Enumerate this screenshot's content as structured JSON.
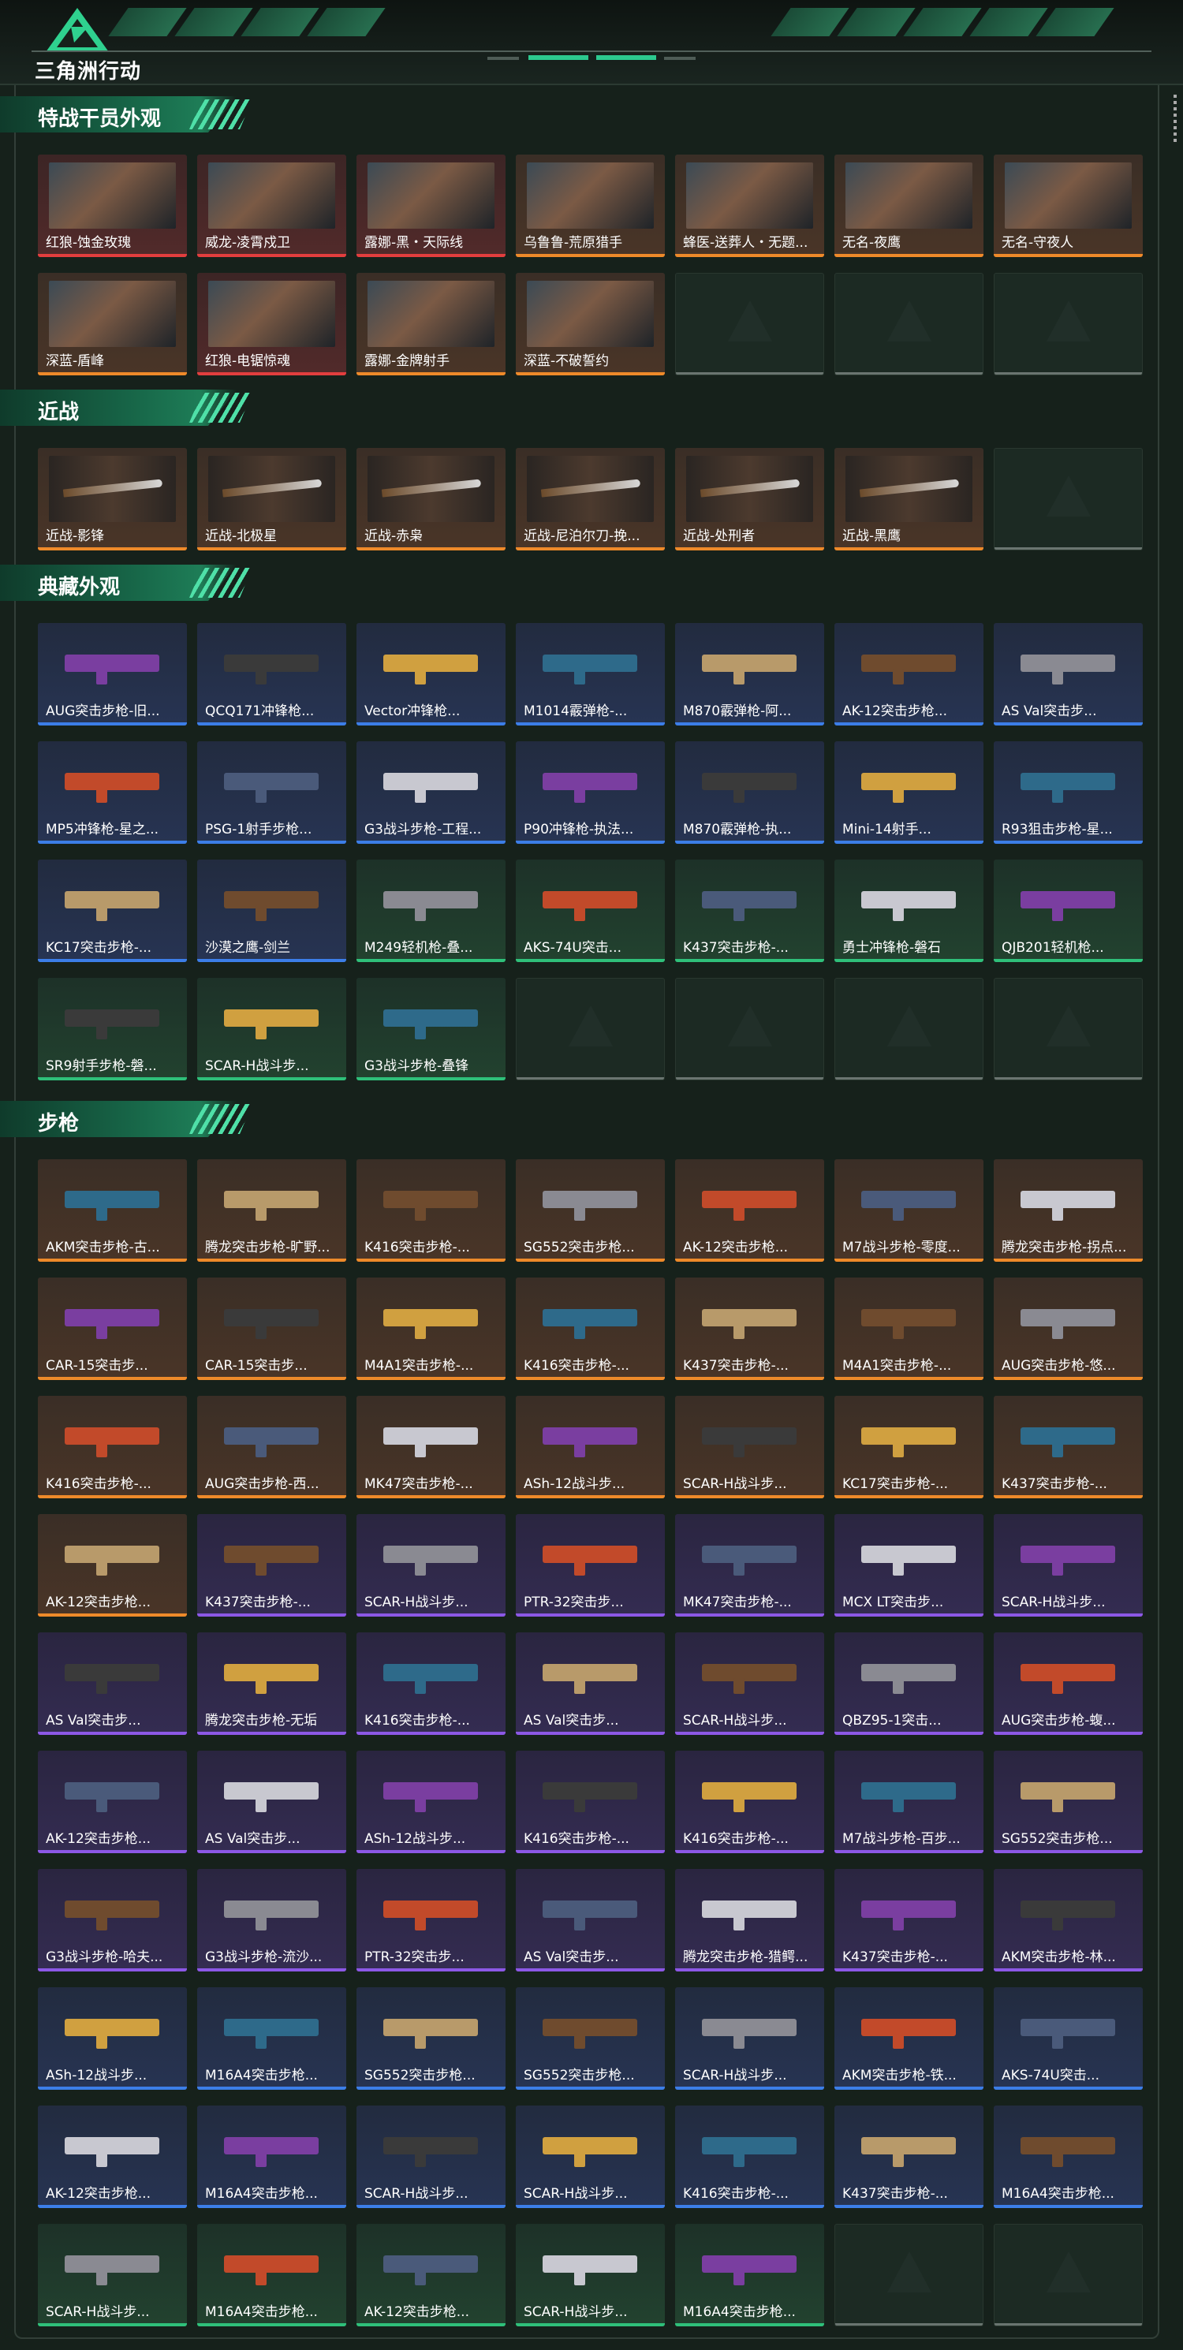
{
  "header": {
    "logo_text": "三角洲行动"
  },
  "sections": [
    {
      "id": "operators",
      "title": "特战干员外观",
      "items": [
        {
          "name": "红狼-蚀金玫瑰",
          "rarity": "red",
          "art": "char"
        },
        {
          "name": "威龙-凌霄戍卫",
          "rarity": "red",
          "art": "char"
        },
        {
          "name": "露娜-黑・天际线",
          "rarity": "red",
          "art": "char"
        },
        {
          "name": "乌鲁鲁-荒原猎手",
          "rarity": "orange",
          "art": "char"
        },
        {
          "name": "蜂医-送葬人・无题...",
          "rarity": "orange",
          "art": "char"
        },
        {
          "name": "无名-夜鹰",
          "rarity": "orange",
          "art": "char"
        },
        {
          "name": "无名-守夜人",
          "rarity": "orange",
          "art": "char"
        },
        {
          "name": "深蓝-盾峰",
          "rarity": "orange",
          "art": "char"
        },
        {
          "name": "红狼-电锯惊魂",
          "rarity": "red",
          "art": "char"
        },
        {
          "name": "露娜-金牌射手",
          "rarity": "orange",
          "art": "char"
        },
        {
          "name": "深蓝-不破誓约",
          "rarity": "orange",
          "art": "char"
        },
        {
          "name": "",
          "rarity": "empty"
        },
        {
          "name": "",
          "rarity": "empty"
        },
        {
          "name": "",
          "rarity": "empty"
        }
      ]
    },
    {
      "id": "melee",
      "title": "近战",
      "items": [
        {
          "name": "近战-影锋",
          "rarity": "orange",
          "art": "melee"
        },
        {
          "name": "近战-北极星",
          "rarity": "orange",
          "art": "melee"
        },
        {
          "name": "近战-赤枭",
          "rarity": "orange",
          "art": "melee"
        },
        {
          "name": "近战-尼泊尔刀-挽...",
          "rarity": "orange",
          "art": "melee"
        },
        {
          "name": "近战-处刑者",
          "rarity": "orange",
          "art": "melee"
        },
        {
          "name": "近战-黑鹰",
          "rarity": "orange",
          "art": "melee"
        },
        {
          "name": "",
          "rarity": "empty"
        }
      ]
    },
    {
      "id": "collection",
      "title": "典藏外观",
      "items": [
        {
          "name": "AUG突击步枪-旧...",
          "rarity": "blue",
          "art": "gun"
        },
        {
          "name": "QCQ171冲锋枪...",
          "rarity": "blue",
          "art": "gun"
        },
        {
          "name": "Vector冲锋枪...",
          "rarity": "blue",
          "art": "gun"
        },
        {
          "name": "M1014霰弹枪-...",
          "rarity": "blue",
          "art": "gun"
        },
        {
          "name": "M870霰弹枪-阿...",
          "rarity": "blue",
          "art": "gun"
        },
        {
          "name": "AK-12突击步枪...",
          "rarity": "blue",
          "art": "gun"
        },
        {
          "name": "AS Val突击步...",
          "rarity": "blue",
          "art": "gun"
        },
        {
          "name": "MP5冲锋枪-星之...",
          "rarity": "blue",
          "art": "gun"
        },
        {
          "name": "PSG-1射手步枪...",
          "rarity": "blue",
          "art": "gun"
        },
        {
          "name": "G3战斗步枪-工程...",
          "rarity": "blue",
          "art": "gun"
        },
        {
          "name": "P90冲锋枪-执法...",
          "rarity": "blue",
          "art": "gun"
        },
        {
          "name": "M870霰弹枪-执...",
          "rarity": "blue",
          "art": "gun"
        },
        {
          "name": "Mini-14射手...",
          "rarity": "blue",
          "art": "gun"
        },
        {
          "name": "R93狙击步枪-星...",
          "rarity": "blue",
          "art": "gun"
        },
        {
          "name": "KC17突击步枪-...",
          "rarity": "blue",
          "art": "gun"
        },
        {
          "name": "沙漠之鹰-剑兰",
          "rarity": "blue",
          "art": "gun"
        },
        {
          "name": "M249轻机枪-叠...",
          "rarity": "green",
          "art": "gun"
        },
        {
          "name": "AKS-74U突击...",
          "rarity": "green",
          "art": "gun"
        },
        {
          "name": "K437突击步枪-...",
          "rarity": "green",
          "art": "gun"
        },
        {
          "name": "勇士冲锋枪-磐石",
          "rarity": "green",
          "art": "gun"
        },
        {
          "name": "QJB201轻机枪...",
          "rarity": "green",
          "art": "gun"
        },
        {
          "name": "SR9射手步枪-磐...",
          "rarity": "green",
          "art": "gun"
        },
        {
          "name": "SCAR-H战斗步...",
          "rarity": "green",
          "art": "gun"
        },
        {
          "name": "G3战斗步枪-叠锋",
          "rarity": "green",
          "art": "gun"
        },
        {
          "name": "",
          "rarity": "empty"
        },
        {
          "name": "",
          "rarity": "empty"
        },
        {
          "name": "",
          "rarity": "empty"
        },
        {
          "name": "",
          "rarity": "empty"
        }
      ]
    },
    {
      "id": "rifles",
      "title": "步枪",
      "items": [
        {
          "name": "AKM突击步枪-古...",
          "rarity": "orange",
          "art": "gun"
        },
        {
          "name": "腾龙突击步枪-旷野...",
          "rarity": "orange",
          "art": "gun"
        },
        {
          "name": "K416突击步枪-...",
          "rarity": "orange",
          "art": "gun"
        },
        {
          "name": "SG552突击步枪...",
          "rarity": "orange",
          "art": "gun"
        },
        {
          "name": "AK-12突击步枪...",
          "rarity": "orange",
          "art": "gun"
        },
        {
          "name": "M7战斗步枪-零度...",
          "rarity": "orange",
          "art": "gun"
        },
        {
          "name": "腾龙突击步枪-拐点...",
          "rarity": "orange",
          "art": "gun"
        },
        {
          "name": "CAR-15突击步...",
          "rarity": "orange",
          "art": "gun"
        },
        {
          "name": "CAR-15突击步...",
          "rarity": "orange",
          "art": "gun"
        },
        {
          "name": "M4A1突击步枪-...",
          "rarity": "orange",
          "art": "gun"
        },
        {
          "name": "K416突击步枪-...",
          "rarity": "orange",
          "art": "gun"
        },
        {
          "name": "K437突击步枪-...",
          "rarity": "orange",
          "art": "gun"
        },
        {
          "name": "M4A1突击步枪-...",
          "rarity": "orange",
          "art": "gun"
        },
        {
          "name": "AUG突击步枪-悠...",
          "rarity": "orange",
          "art": "gun"
        },
        {
          "name": "K416突击步枪-...",
          "rarity": "orange",
          "art": "gun"
        },
        {
          "name": "AUG突击步枪-西...",
          "rarity": "orange",
          "art": "gun"
        },
        {
          "name": "MK47突击步枪-...",
          "rarity": "orange",
          "art": "gun"
        },
        {
          "name": "ASh-12战斗步...",
          "rarity": "orange",
          "art": "gun"
        },
        {
          "name": "SCAR-H战斗步...",
          "rarity": "orange",
          "art": "gun"
        },
        {
          "name": "KC17突击步枪-...",
          "rarity": "orange",
          "art": "gun"
        },
        {
          "name": "K437突击步枪-...",
          "rarity": "orange",
          "art": "gun"
        },
        {
          "name": "AK-12突击步枪...",
          "rarity": "orange",
          "art": "gun"
        },
        {
          "name": "K437突击步枪-...",
          "rarity": "purple",
          "art": "gun"
        },
        {
          "name": "SCAR-H战斗步...",
          "rarity": "purple",
          "art": "gun"
        },
        {
          "name": "PTR-32突击步...",
          "rarity": "purple",
          "art": "gun"
        },
        {
          "name": "MK47突击步枪-...",
          "rarity": "purple",
          "art": "gun"
        },
        {
          "name": "MCX LT突击步...",
          "rarity": "purple",
          "art": "gun"
        },
        {
          "name": "SCAR-H战斗步...",
          "rarity": "purple",
          "art": "gun"
        },
        {
          "name": "AS Val突击步...",
          "rarity": "purple",
          "art": "gun"
        },
        {
          "name": "腾龙突击步枪-无垢",
          "rarity": "purple",
          "art": "gun"
        },
        {
          "name": "K416突击步枪-...",
          "rarity": "purple",
          "art": "gun"
        },
        {
          "name": "AS Val突击步...",
          "rarity": "purple",
          "art": "gun"
        },
        {
          "name": "SCAR-H战斗步...",
          "rarity": "purple",
          "art": "gun"
        },
        {
          "name": "QBZ95-1突击...",
          "rarity": "purple",
          "art": "gun"
        },
        {
          "name": "AUG突击步枪-蝮...",
          "rarity": "purple",
          "art": "gun"
        },
        {
          "name": "AK-12突击步枪...",
          "rarity": "purple",
          "art": "gun"
        },
        {
          "name": "AS Val突击步...",
          "rarity": "purple",
          "art": "gun"
        },
        {
          "name": "ASh-12战斗步...",
          "rarity": "purple",
          "art": "gun"
        },
        {
          "name": "K416突击步枪-...",
          "rarity": "purple",
          "art": "gun"
        },
        {
          "name": "K416突击步枪-...",
          "rarity": "purple",
          "art": "gun"
        },
        {
          "name": "M7战斗步枪-百步...",
          "rarity": "purple",
          "art": "gun"
        },
        {
          "name": "SG552突击步枪...",
          "rarity": "purple",
          "art": "gun"
        },
        {
          "name": "G3战斗步枪-哈夫...",
          "rarity": "purple",
          "art": "gun"
        },
        {
          "name": "G3战斗步枪-流沙...",
          "rarity": "purple",
          "art": "gun"
        },
        {
          "name": "PTR-32突击步...",
          "rarity": "purple",
          "art": "gun"
        },
        {
          "name": "AS Val突击步...",
          "rarity": "purple",
          "art": "gun"
        },
        {
          "name": "腾龙突击步枪-猎鳄...",
          "rarity": "purple",
          "art": "gun"
        },
        {
          "name": "K437突击步枪-...",
          "rarity": "purple",
          "art": "gun"
        },
        {
          "name": "AKM突击步枪-林...",
          "rarity": "purple",
          "art": "gun"
        },
        {
          "name": "ASh-12战斗步...",
          "rarity": "blue",
          "art": "gun"
        },
        {
          "name": "M16A4突击步枪...",
          "rarity": "blue",
          "art": "gun"
        },
        {
          "name": "SG552突击步枪...",
          "rarity": "blue",
          "art": "gun"
        },
        {
          "name": "SG552突击步枪...",
          "rarity": "blue",
          "art": "gun"
        },
        {
          "name": "SCAR-H战斗步...",
          "rarity": "blue",
          "art": "gun"
        },
        {
          "name": "AKM突击步枪-铁...",
          "rarity": "blue",
          "art": "gun"
        },
        {
          "name": "AKS-74U突击...",
          "rarity": "blue",
          "art": "gun"
        },
        {
          "name": "AK-12突击步枪...",
          "rarity": "blue",
          "art": "gun"
        },
        {
          "name": "M16A4突击步枪...",
          "rarity": "blue",
          "art": "gun"
        },
        {
          "name": "SCAR-H战斗步...",
          "rarity": "blue",
          "art": "gun"
        },
        {
          "name": "SCAR-H战斗步...",
          "rarity": "blue",
          "art": "gun"
        },
        {
          "name": "K416突击步枪-...",
          "rarity": "blue",
          "art": "gun"
        },
        {
          "name": "K437突击步枪-...",
          "rarity": "blue",
          "art": "gun"
        },
        {
          "name": "M16A4突击步枪...",
          "rarity": "blue",
          "art": "gun"
        },
        {
          "name": "SCAR-H战斗步...",
          "rarity": "green",
          "art": "gun"
        },
        {
          "name": "M16A4突击步枪...",
          "rarity": "green",
          "art": "gun"
        },
        {
          "name": "AK-12突击步枪...",
          "rarity": "green",
          "art": "gun"
        },
        {
          "name": "SCAR-H战斗步...",
          "rarity": "green",
          "art": "gun"
        },
        {
          "name": "M16A4突击步枪...",
          "rarity": "green",
          "art": "gun"
        },
        {
          "name": "",
          "rarity": "empty"
        },
        {
          "name": "",
          "rarity": "empty"
        }
      ]
    }
  ],
  "colors": {
    "accent": "#2cc98f",
    "red": "#e23e3e",
    "orange": "#ee8a2a",
    "blue": "#3c7ee8",
    "green": "#2fc07a",
    "purple": "#8c58e6"
  }
}
